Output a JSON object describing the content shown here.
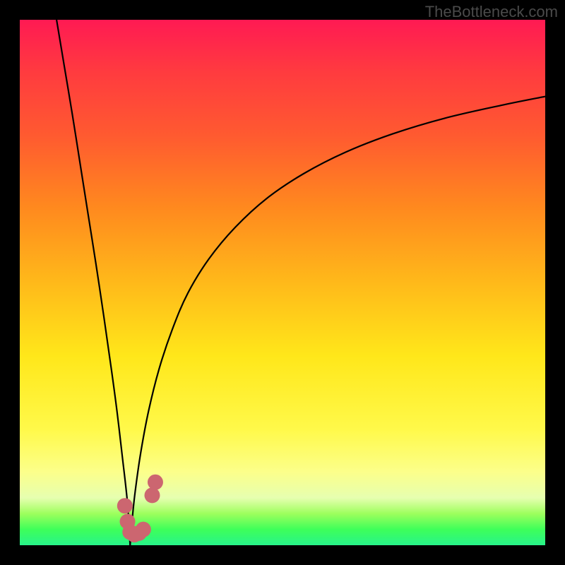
{
  "watermark": "TheBottleneck.com",
  "chart_data": {
    "type": "line",
    "title": "",
    "xlabel": "",
    "ylabel": "",
    "xlim": [
      0,
      100
    ],
    "ylim": [
      0,
      100
    ],
    "grid": false,
    "notch_x": 21,
    "series": [
      {
        "name": "left-curve",
        "x": [
          7,
          8.5,
          10,
          11.5,
          13,
          14.5,
          16,
          17.5,
          18.5,
          19.5,
          20.5,
          21
        ],
        "values": [
          100,
          91,
          82,
          72.5,
          63,
          53.5,
          43.5,
          33,
          25.5,
          17,
          8,
          0
        ]
      },
      {
        "name": "right-curve",
        "x": [
          21,
          21.5,
          22,
          23,
          24.5,
          26.5,
          29,
          32,
          36,
          41,
          47,
          54,
          62,
          71,
          81,
          92,
          100
        ],
        "values": [
          0,
          6,
          10.5,
          17.5,
          25.5,
          33.5,
          41,
          48,
          54.5,
          60.5,
          66,
          70.7,
          74.8,
          78.3,
          81.3,
          83.8,
          85.4
        ]
      }
    ],
    "markers": [
      {
        "name": "marker-1",
        "x": 20.0,
        "y": 7.5
      },
      {
        "name": "marker-2",
        "x": 20.5,
        "y": 4.5
      },
      {
        "name": "marker-3",
        "x": 21.0,
        "y": 2.5
      },
      {
        "name": "marker-4",
        "x": 21.8,
        "y": 2.0
      },
      {
        "name": "marker-5",
        "x": 22.7,
        "y": 2.3
      },
      {
        "name": "marker-6",
        "x": 23.5,
        "y": 3.0
      },
      {
        "name": "marker-7",
        "x": 25.2,
        "y": 9.5
      },
      {
        "name": "marker-8",
        "x": 25.8,
        "y": 12.0
      }
    ],
    "marker_color": "#cc6670",
    "curve_color": "#000000",
    "marker_radius_px": 11
  }
}
